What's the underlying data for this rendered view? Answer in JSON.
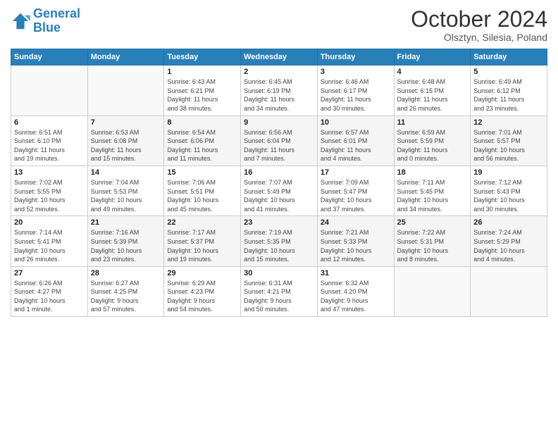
{
  "header": {
    "logo_line1": "General",
    "logo_line2": "Blue",
    "title": "October 2024",
    "subtitle": "Olsztyn, Silesia, Poland"
  },
  "days_of_week": [
    "Sunday",
    "Monday",
    "Tuesday",
    "Wednesday",
    "Thursday",
    "Friday",
    "Saturday"
  ],
  "weeks": [
    [
      {
        "num": "",
        "info": ""
      },
      {
        "num": "",
        "info": ""
      },
      {
        "num": "1",
        "info": "Sunrise: 6:43 AM\nSunset: 6:21 PM\nDaylight: 11 hours\nand 38 minutes."
      },
      {
        "num": "2",
        "info": "Sunrise: 6:45 AM\nSunset: 6:19 PM\nDaylight: 11 hours\nand 34 minutes."
      },
      {
        "num": "3",
        "info": "Sunrise: 6:46 AM\nSunset: 6:17 PM\nDaylight: 11 hours\nand 30 minutes."
      },
      {
        "num": "4",
        "info": "Sunrise: 6:48 AM\nSunset: 6:15 PM\nDaylight: 11 hours\nand 26 minutes."
      },
      {
        "num": "5",
        "info": "Sunrise: 6:49 AM\nSunset: 6:12 PM\nDaylight: 11 hours\nand 23 minutes."
      }
    ],
    [
      {
        "num": "6",
        "info": "Sunrise: 6:51 AM\nSunset: 6:10 PM\nDaylight: 11 hours\nand 19 minutes."
      },
      {
        "num": "7",
        "info": "Sunrise: 6:53 AM\nSunset: 6:08 PM\nDaylight: 11 hours\nand 15 minutes."
      },
      {
        "num": "8",
        "info": "Sunrise: 6:54 AM\nSunset: 6:06 PM\nDaylight: 11 hours\nand 11 minutes."
      },
      {
        "num": "9",
        "info": "Sunrise: 6:56 AM\nSunset: 6:04 PM\nDaylight: 11 hours\nand 7 minutes."
      },
      {
        "num": "10",
        "info": "Sunrise: 6:57 AM\nSunset: 6:01 PM\nDaylight: 11 hours\nand 4 minutes."
      },
      {
        "num": "11",
        "info": "Sunrise: 6:59 AM\nSunset: 5:59 PM\nDaylight: 11 hours\nand 0 minutes."
      },
      {
        "num": "12",
        "info": "Sunrise: 7:01 AM\nSunset: 5:57 PM\nDaylight: 10 hours\nand 56 minutes."
      }
    ],
    [
      {
        "num": "13",
        "info": "Sunrise: 7:02 AM\nSunset: 5:55 PM\nDaylight: 10 hours\nand 52 minutes."
      },
      {
        "num": "14",
        "info": "Sunrise: 7:04 AM\nSunset: 5:53 PM\nDaylight: 10 hours\nand 49 minutes."
      },
      {
        "num": "15",
        "info": "Sunrise: 7:06 AM\nSunset: 5:51 PM\nDaylight: 10 hours\nand 45 minutes."
      },
      {
        "num": "16",
        "info": "Sunrise: 7:07 AM\nSunset: 5:49 PM\nDaylight: 10 hours\nand 41 minutes."
      },
      {
        "num": "17",
        "info": "Sunrise: 7:09 AM\nSunset: 5:47 PM\nDaylight: 10 hours\nand 37 minutes."
      },
      {
        "num": "18",
        "info": "Sunrise: 7:11 AM\nSunset: 5:45 PM\nDaylight: 10 hours\nand 34 minutes."
      },
      {
        "num": "19",
        "info": "Sunrise: 7:12 AM\nSunset: 5:43 PM\nDaylight: 10 hours\nand 30 minutes."
      }
    ],
    [
      {
        "num": "20",
        "info": "Sunrise: 7:14 AM\nSunset: 5:41 PM\nDaylight: 10 hours\nand 26 minutes."
      },
      {
        "num": "21",
        "info": "Sunrise: 7:16 AM\nSunset: 5:39 PM\nDaylight: 10 hours\nand 23 minutes."
      },
      {
        "num": "22",
        "info": "Sunrise: 7:17 AM\nSunset: 5:37 PM\nDaylight: 10 hours\nand 19 minutes."
      },
      {
        "num": "23",
        "info": "Sunrise: 7:19 AM\nSunset: 5:35 PM\nDaylight: 10 hours\nand 15 minutes."
      },
      {
        "num": "24",
        "info": "Sunrise: 7:21 AM\nSunset: 5:33 PM\nDaylight: 10 hours\nand 12 minutes."
      },
      {
        "num": "25",
        "info": "Sunrise: 7:22 AM\nSunset: 5:31 PM\nDaylight: 10 hours\nand 8 minutes."
      },
      {
        "num": "26",
        "info": "Sunrise: 7:24 AM\nSunset: 5:29 PM\nDaylight: 10 hours\nand 4 minutes."
      }
    ],
    [
      {
        "num": "27",
        "info": "Sunrise: 6:26 AM\nSunset: 4:27 PM\nDaylight: 10 hours\nand 1 minute."
      },
      {
        "num": "28",
        "info": "Sunrise: 6:27 AM\nSunset: 4:25 PM\nDaylight: 9 hours\nand 57 minutes."
      },
      {
        "num": "29",
        "info": "Sunrise: 6:29 AM\nSunset: 4:23 PM\nDaylight: 9 hours\nand 54 minutes."
      },
      {
        "num": "30",
        "info": "Sunrise: 6:31 AM\nSunset: 4:21 PM\nDaylight: 9 hours\nand 50 minutes."
      },
      {
        "num": "31",
        "info": "Sunrise: 6:32 AM\nSunset: 4:20 PM\nDaylight: 9 hours\nand 47 minutes."
      },
      {
        "num": "",
        "info": ""
      },
      {
        "num": "",
        "info": ""
      }
    ]
  ]
}
